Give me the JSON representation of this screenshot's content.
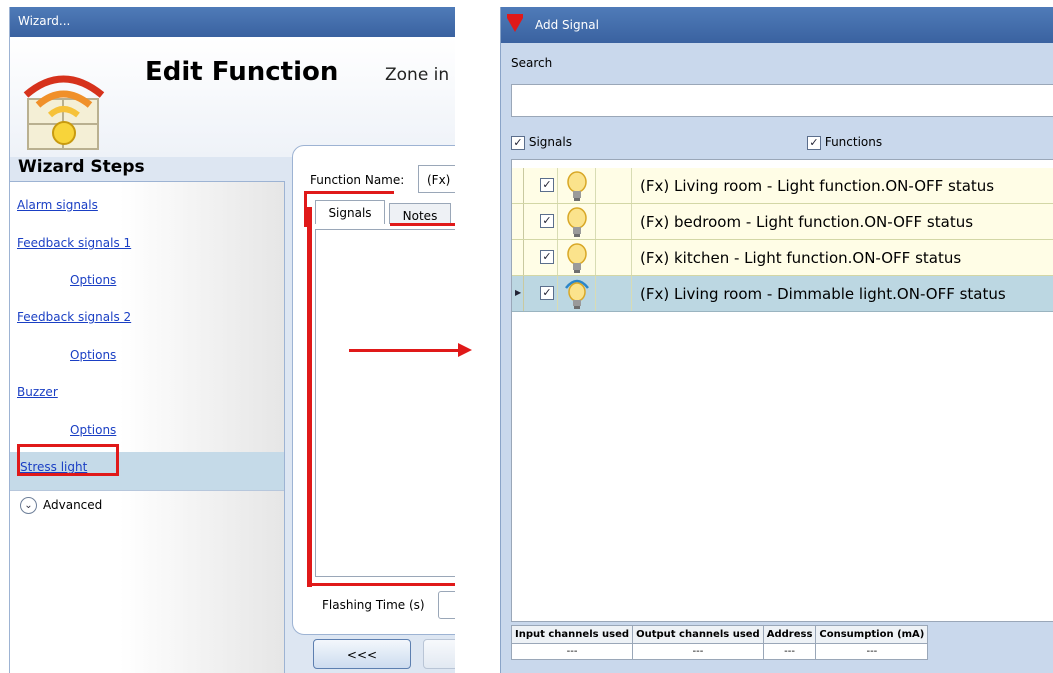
{
  "left_window": {
    "title": "Wizard...",
    "header_title": "Edit Function",
    "header_subtitle": "Zone in",
    "steps_title": "Wizard Steps",
    "steps": [
      {
        "label": "Alarm signals"
      },
      {
        "label": "Feedback signals 1"
      },
      {
        "label": "Options"
      },
      {
        "label": "Feedback signals 2"
      },
      {
        "label": "Options"
      },
      {
        "label": "Buzzer"
      },
      {
        "label": "Options"
      },
      {
        "label": "Stress light",
        "selected": true
      }
    ],
    "advanced_label": "Advanced",
    "function_name_label": "Function Name:",
    "function_name_value": "(Fx)",
    "tabs": [
      {
        "label": "Signals",
        "active": true
      },
      {
        "label": "Notes"
      }
    ],
    "flashing_time_label": "Flashing Time (s)",
    "back_button_label": "<<<"
  },
  "right_window": {
    "title": "Add Signal",
    "search_label": "Search",
    "search_value": "",
    "filters": {
      "signals_label": "Signals",
      "signals_checked": true,
      "functions_label": "Functions",
      "functions_checked": true
    },
    "signal_rows": [
      {
        "text": "(Fx) Living room - Light function.ON-OFF status",
        "checked": true,
        "icon": "light-bulb-icon"
      },
      {
        "text": "(Fx) bedroom - Light function.ON-OFF status",
        "checked": true,
        "icon": "light-bulb-icon"
      },
      {
        "text": "(Fx) kitchen - Light function.ON-OFF status",
        "checked": true,
        "icon": "light-bulb-icon"
      },
      {
        "text": "(Fx) Living room - Dimmable light.ON-OFF status",
        "checked": true,
        "icon": "dimmable-bulb-icon",
        "selected": true
      }
    ],
    "footer": {
      "headers": [
        "Input channels used",
        "Output channels used",
        "Address",
        "Consumption (mA)"
      ],
      "values": [
        "---",
        "---",
        "---",
        "---"
      ]
    }
  },
  "colors": {
    "titlebar": "#3f69a8",
    "highlight_red": "#e01919",
    "row_background": "#fffde6",
    "row_selected": "#bcd7e2",
    "link_blue": "#1a3fc4"
  }
}
